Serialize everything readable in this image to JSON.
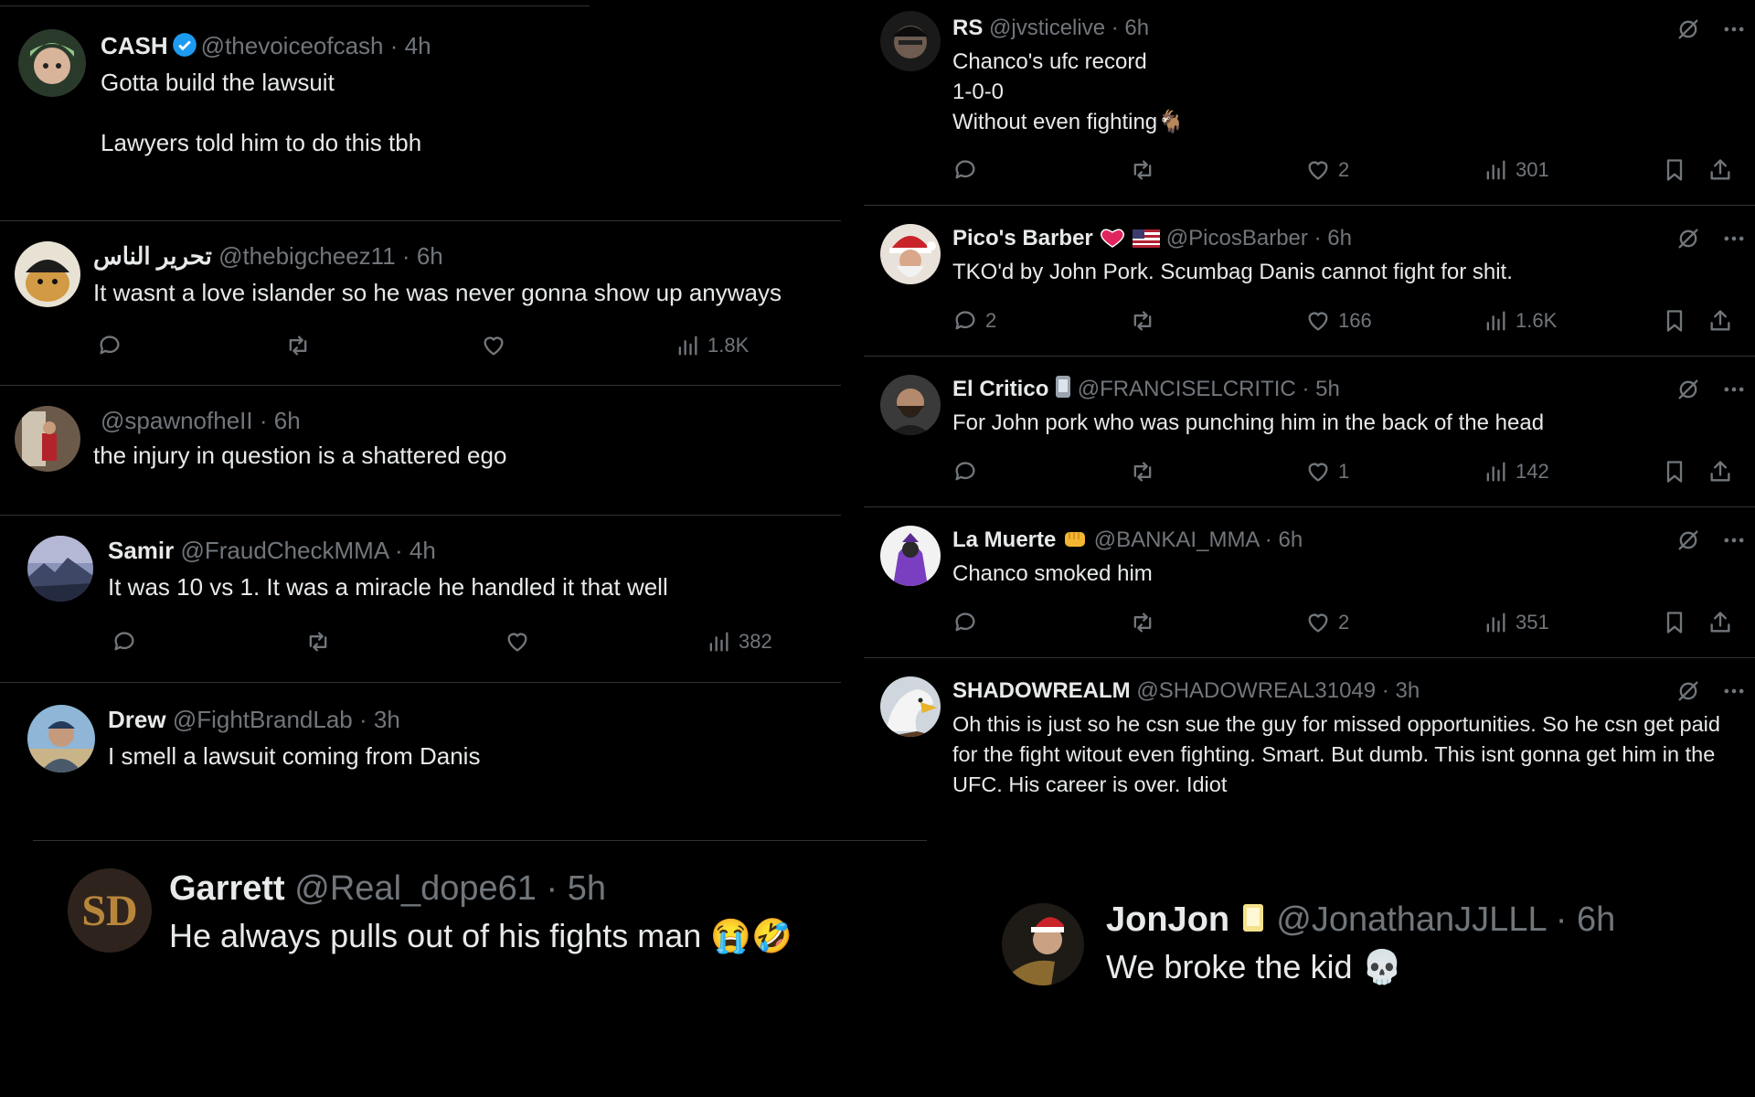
{
  "left": [
    {
      "name": "CASH",
      "handle": "@thevoiceofcash",
      "time": "4h",
      "text": "Gotta build the lawsuit\n\nLawyers told him to do this tbh",
      "verified": true
    },
    {
      "name": "تحرير الناس",
      "handle": "@thebigcheez11",
      "time": "6h",
      "text": "It wasnt a love islander so he was never gonna show up anyways",
      "views": "1.8K"
    },
    {
      "name": "",
      "handle": "@spawnofheII",
      "time": "6h",
      "text": "the injury in question is a shattered ego"
    },
    {
      "name": "Samir",
      "handle": "@FraudCheckMMA",
      "time": "4h",
      "text": "It was 10 vs 1. It was a miracle he handled it that well",
      "views": "382"
    },
    {
      "name": "Drew",
      "handle": "@FightBrandLab",
      "time": "3h",
      "text": "I smell a lawsuit coming from Danis"
    }
  ],
  "right": [
    {
      "name": "RS",
      "handle": "@jvsticelive",
      "time": "6h",
      "text": "Chanco's ufc record\n1-0-0\nWithout even fighting🐐",
      "replies": "",
      "likes": "2",
      "views": "301"
    },
    {
      "name": "Pico's Barber",
      "handle": "@PicosBarber",
      "time": "6h",
      "text": "TKO'd by John Pork. Scumbag Danis cannot fight for shit.",
      "replies": "2",
      "likes": "166",
      "views": "1.6K"
    },
    {
      "name": "El Critico",
      "handle": "@FRANCISELCRITIC",
      "time": "5h",
      "text": "For John pork who was punching him in the back of the head",
      "replies": "",
      "likes": "1",
      "views": "142"
    },
    {
      "name": "La Muerte",
      "handle": "@BANKAI_MMA",
      "time": "6h",
      "text": "Chanco smoked him",
      "replies": "",
      "likes": "2",
      "views": "351"
    },
    {
      "name": "SHADOWREALM",
      "handle": "@SHADOWREAL31049",
      "time": "3h",
      "text": "Oh this is just so he csn sue the guy for missed opportunities. So he csn get paid for the fight witout even fighting. Smart. But dumb. This isnt gonna get him in the UFC. His career is over. Idiot"
    }
  ],
  "bottom_left": {
    "name": "Garrett",
    "handle": "@Real_dope61",
    "time": "5h",
    "text": "He always pulls out of his fights man 😭🤣"
  },
  "bottom_right": {
    "name": "JonJon",
    "handle": "@JonathanJJLLL",
    "time": "6h",
    "text": "We broke the kid 💀"
  },
  "separator": "·",
  "colors": {
    "background": "#000000",
    "text": "#e7e9ea",
    "muted": "#71767b",
    "divider": "#2f3336",
    "verified": "#1d9bf0"
  }
}
